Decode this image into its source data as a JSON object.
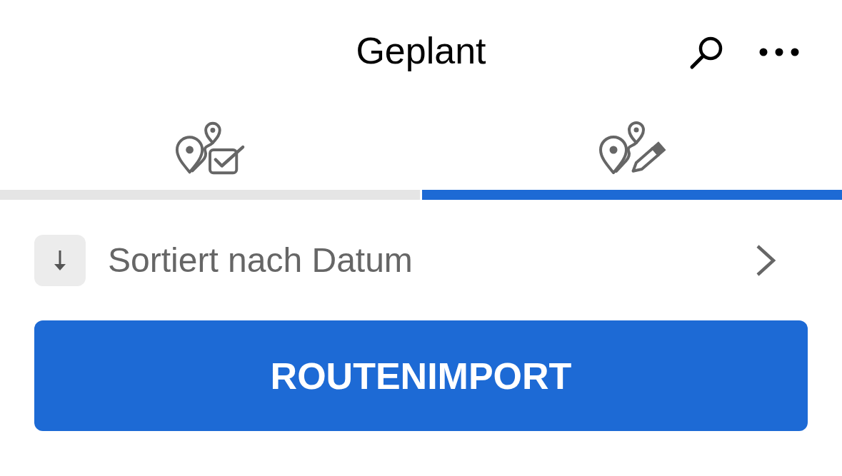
{
  "header": {
    "title": "Geplant"
  },
  "tabs": [
    {
      "kind": "check",
      "selected": false
    },
    {
      "kind": "edit",
      "selected": true
    }
  ],
  "sort": {
    "label": "Sortiert nach Datum"
  },
  "import_button": {
    "label": "ROUTENIMPORT"
  }
}
